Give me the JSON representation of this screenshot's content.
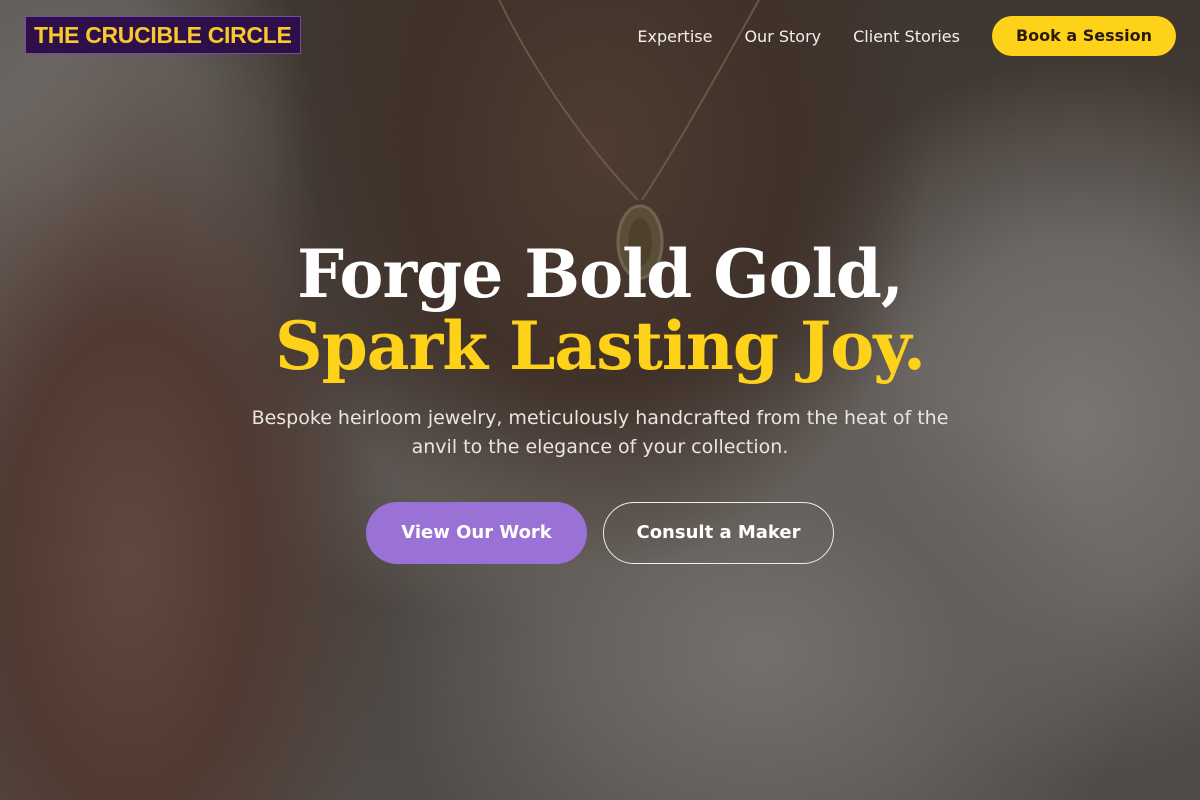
{
  "brand": {
    "logo_text": "THE CRUCIBLE CIRCLE",
    "logo_bg": "#2e0f4a",
    "logo_color": "#f7c92b"
  },
  "nav": {
    "items": [
      {
        "label": "Expertise"
      },
      {
        "label": "Our Story"
      },
      {
        "label": "Client Stories"
      }
    ],
    "cta_label": "Book a Session",
    "cta_color": "#ffd21a"
  },
  "hero": {
    "headline_line1": "Forge Bold Gold,",
    "headline_line2": "Spark Lasting Joy.",
    "accent_color": "#ffd21a",
    "subheadline": "Bespoke heirloom jewelry, meticulously handcrafted from the heat of the anvil to the elegance of your collection.",
    "primary_button": "View Our Work",
    "primary_button_color": "#9a72d6",
    "secondary_button": "Consult a Maker"
  }
}
